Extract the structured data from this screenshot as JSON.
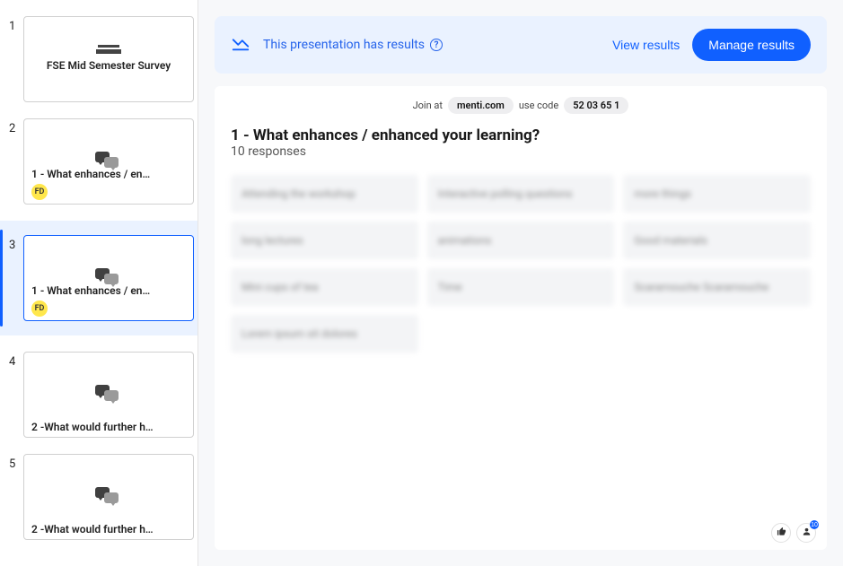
{
  "sidebar": {
    "slides": [
      {
        "num": "1",
        "type": "title",
        "title": "FSE Mid Semester Survey",
        "fd": false,
        "selected": false
      },
      {
        "num": "2",
        "type": "openended",
        "title": "1 - What enhances / en…",
        "fd": true,
        "selected": false
      },
      {
        "num": "3",
        "type": "openended",
        "title": "1 - What enhances / en…",
        "fd": true,
        "selected": true
      },
      {
        "num": "4",
        "type": "openended",
        "title": "2 -What would further h…",
        "fd": false,
        "selected": false
      },
      {
        "num": "5",
        "type": "openended",
        "title": "2 -What would further h…",
        "fd": false,
        "selected": false
      }
    ],
    "fd_label": "FD"
  },
  "banner": {
    "text": "This presentation has results",
    "view_results": "View results",
    "manage_results": "Manage results"
  },
  "preview": {
    "join_prefix": "Join at",
    "join_domain": "menti.com",
    "join_code_label": "use code",
    "join_code": "52 03 65 1",
    "question": "1 - What enhances / enhanced your learning?",
    "responses_count": "10 responses",
    "responses": [
      "Attending the workshop",
      "Interactive polling questions",
      "more things",
      "long lectures",
      "animations",
      "Good materials",
      "Mini cups of tea",
      "Time",
      "Scaramouche Scaramouche",
      "Lorem ipsum sit dolores"
    ],
    "badge_count": "10"
  }
}
